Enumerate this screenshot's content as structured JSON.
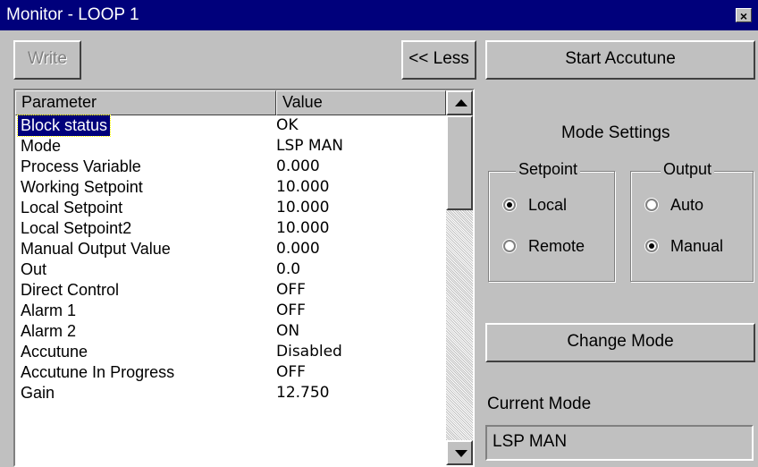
{
  "window": {
    "title": "Monitor - LOOP 1",
    "close_glyph": "×"
  },
  "toolbar": {
    "write_label": "Write",
    "less_label": "<< Less",
    "accutune_label": "Start Accutune"
  },
  "table": {
    "columns": [
      "Parameter",
      "Value"
    ],
    "rows": [
      {
        "parameter": "Block status",
        "value": "OK",
        "selected": true
      },
      {
        "parameter": "Mode",
        "value": "LSP MAN"
      },
      {
        "parameter": "Process Variable",
        "value": "0.000"
      },
      {
        "parameter": "Working Setpoint",
        "value": "10.000"
      },
      {
        "parameter": "Local Setpoint",
        "value": "10.000"
      },
      {
        "parameter": "Local Setpoint2",
        "value": "10.000"
      },
      {
        "parameter": "Manual Output Value",
        "value": "0.000"
      },
      {
        "parameter": "Out",
        "value": "0.0"
      },
      {
        "parameter": "Direct Control",
        "value": "OFF"
      },
      {
        "parameter": "Alarm 1",
        "value": "OFF"
      },
      {
        "parameter": "Alarm 2",
        "value": "ON"
      },
      {
        "parameter": "Accutune",
        "value": "Disabled"
      },
      {
        "parameter": "Accutune In Progress",
        "value": "OFF"
      },
      {
        "parameter": "Gain",
        "value": "12.750"
      }
    ]
  },
  "mode_settings": {
    "title": "Mode Settings",
    "setpoint": {
      "title": "Setpoint",
      "options": [
        "Local",
        "Remote"
      ],
      "selected": "Local"
    },
    "output": {
      "title": "Output",
      "options": [
        "Auto",
        "Manual"
      ],
      "selected": "Manual"
    },
    "change_mode_label": "Change Mode",
    "current_mode_label": "Current Mode",
    "current_mode_value": "LSP MAN"
  }
}
